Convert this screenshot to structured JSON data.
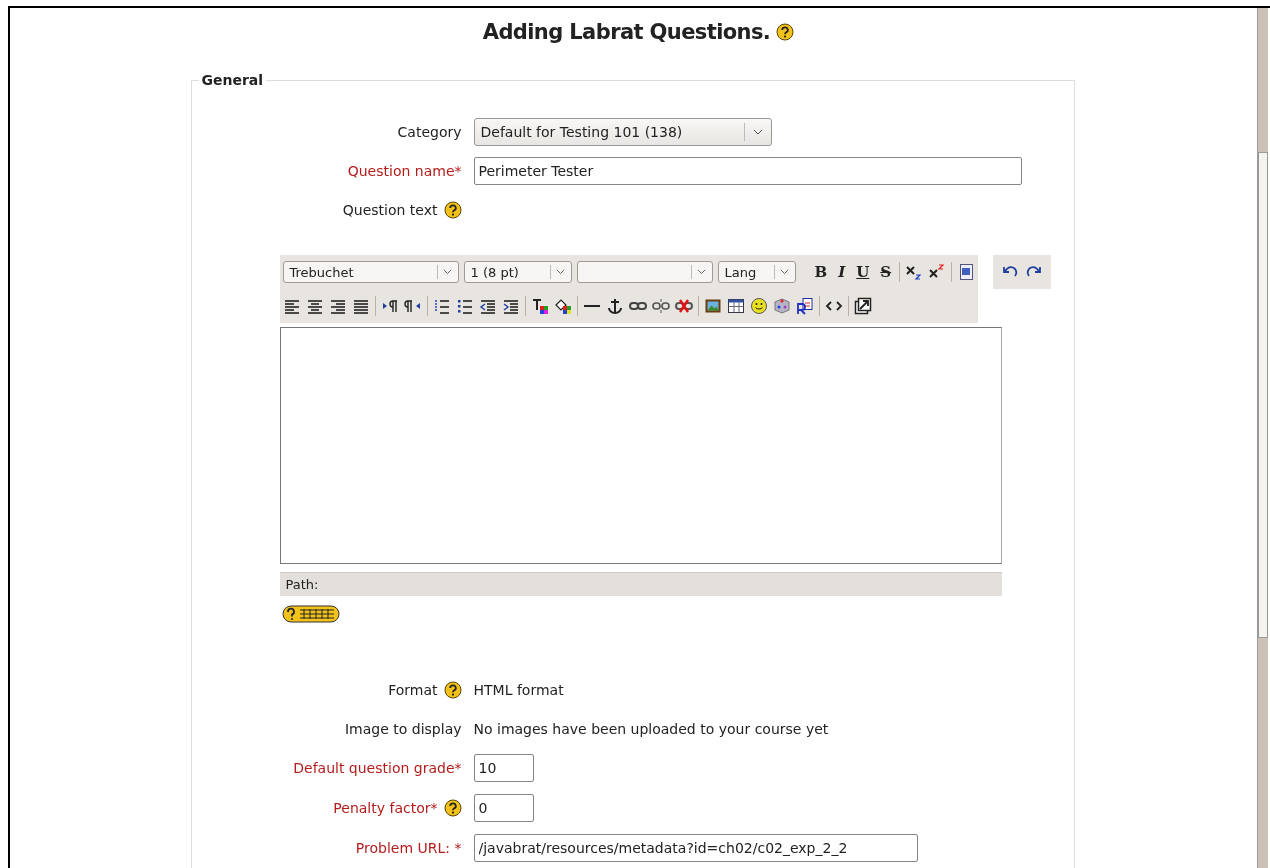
{
  "page_title": "Adding Labrat Questions.",
  "title_help": true,
  "section": {
    "legend": "General"
  },
  "fields": [
    {
      "kind": "select",
      "label": "Category",
      "required": false,
      "help": false,
      "value": "Default for Testing 101 (138)"
    },
    {
      "kind": "text",
      "label": "Question name*",
      "required": true,
      "help": false,
      "value": "Perimeter Tester"
    },
    {
      "kind": "editor",
      "label": "Question text",
      "required": false,
      "help": true
    },
    {
      "kind": "static",
      "label": "Format",
      "required": false,
      "help": true,
      "value": "HTML format"
    },
    {
      "kind": "static",
      "label": "Image to display",
      "required": false,
      "help": false,
      "value": "No images have been uploaded to your course yet"
    },
    {
      "kind": "short",
      "label": "Default question grade*",
      "required": true,
      "help": false,
      "value": "10"
    },
    {
      "kind": "short",
      "label": "Penalty factor*",
      "required": true,
      "help": true,
      "value": "0"
    },
    {
      "kind": "wide",
      "label": "Problem URL: *",
      "required": true,
      "help": false,
      "value": "/javabrat/resources/metadata?id=ch02/c02_exp_2_2"
    }
  ],
  "editor": {
    "font": "Trebuchet",
    "size": "1 (8 pt)",
    "lang": "Lang",
    "style_buttons": [
      "B",
      "I",
      "U",
      "S"
    ],
    "path_label": "Path:"
  }
}
